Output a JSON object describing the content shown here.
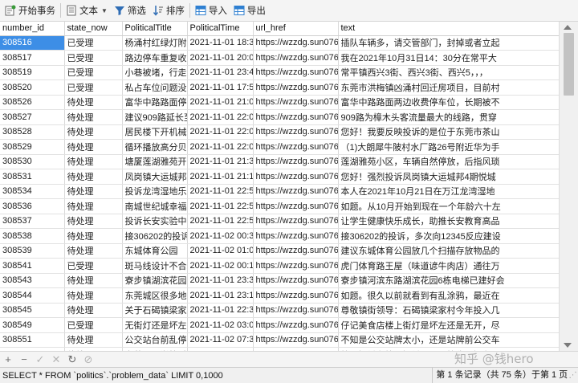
{
  "toolbar": {
    "begin_transaction": "开始事务",
    "text": "文本",
    "filter": "筛选",
    "sort": "排序",
    "import": "导入",
    "export": "导出"
  },
  "columns": [
    "number_id",
    "state_now",
    "PoliticalTitle",
    "PoliticalTime",
    "url_href",
    "text"
  ],
  "rows": [
    [
      "308516",
      "已受理",
      "杨涌村红绿灯附近",
      "2021-11-01 18:38",
      "https://wzzdg.sun0769",
      "插队车辆多，请交管部门，封掉或者立起"
    ],
    [
      "308517",
      "已受理",
      "路边停车重复收费",
      "2021-11-01 20:09",
      "https://wzzdg.sun0769",
      "我在2021年10月31日14：30分在常平大"
    ],
    [
      "308519",
      "已受理",
      "小巷被堵，行走不",
      "2021-11-01 23:41",
      "https://wzzdg.sun0769",
      "常平镇西兴3街、西兴3街、西兴5，，，"
    ],
    [
      "308520",
      "已受理",
      "私占车位问题没有",
      "2021-11-01 17:55",
      "https://wzzdg.sun0769",
      "东莞市洪梅镇凶涌村回迁房项目，目前村"
    ],
    [
      "308526",
      "待处理",
      "富华中路路面停车",
      "2021-11-01 21:09",
      "https://wzzdg.sun0769",
      "富华中路路面两边收费停车位，长期被不"
    ],
    [
      "308527",
      "待处理",
      "建议909路延长至",
      "2021-11-01 22:03",
      "https://wzzdg.sun0769",
      "909路为樟木头客流量最大的线路，贯穿"
    ],
    [
      "308528",
      "待处理",
      "居民楼下开机械厂",
      "2021-11-01 22:05",
      "https://wzzdg.sun0769",
      "您好！我要反映投诉的是位于东莞市茶山"
    ],
    [
      "308529",
      "待处理",
      "循环播放高分贝噪",
      "2021-11-01 22:00",
      "https://wzzdg.sun0769",
      "（1)大朗犀牛陂村水厂路26号附近华为手"
    ],
    [
      "308530",
      "待处理",
      "塘厦莲湖雅苑开发",
      "2021-11-01 21:39",
      "https://wzzdg.sun0769",
      "莲湖雅苑小区，车辆自然停放，后指风琐"
    ],
    [
      "308531",
      "待处理",
      "凤岗镇大运城邦四",
      "2021-11-01 21:18",
      "https://wzzdg.sun0769",
      "您好！强烈投诉凤岗镇大运城邦4期悦城"
    ],
    [
      "308534",
      "待处理",
      "投诉龙湾湿地乐园",
      "2021-11-01 22:58",
      "https://wzzdg.sun0769",
      "本人在2021年10月21日在万江龙湾湿地"
    ],
    [
      "308536",
      "待处理",
      "南城世纪城幸福公",
      "2021-11-01 22:57",
      "https://wzzdg.sun0769",
      "如题。从10月开始到现在一个年龄六十左"
    ],
    [
      "308537",
      "待处理",
      "投诉长安实验中学",
      "2021-11-01 22:53",
      "https://wzzdg.sun0769",
      "让学生健康快乐成长，助推长安教育高品"
    ],
    [
      "308538",
      "待处理",
      "接306202的投诉，",
      "2021-11-02 00:37",
      "https://wzzdg.sun0769",
      "接306202的投诉，多次向12345反应建设"
    ],
    [
      "308539",
      "待处理",
      "东城体育公园",
      "2021-11-02 01:07",
      "https://wzzdg.sun0769",
      "建议东城体育公园放几个扫描存放物品的"
    ],
    [
      "308541",
      "已受理",
      "斑马线设计不合理",
      "2021-11-02 00:11",
      "https://wzzdg.sun0769",
      "虎门体育路王屋（味道谚牛肉店）通往万"
    ],
    [
      "308543",
      "待处理",
      "寮步镇湖滨花园建",
      "2021-11-01 23:39",
      "https://wzzdg.sun0769",
      "寮步镇河滨东路湖滨花园6栋电梯已建好会"
    ],
    [
      "308544",
      "待处理",
      "东莞城区很多地方",
      "2021-11-01 23:18",
      "https://wzzdg.sun0769",
      "如题。很久以前就看到有乱涂鸦，最近在"
    ],
    [
      "308545",
      "待处理",
      "关于石碣镇梁家村",
      "2021-11-01 22:35",
      "https://wzzdg.sun0769",
      "尊敬镇街领导：石碣镇梁家村今年投入几"
    ],
    [
      "308549",
      "已受理",
      "无街灯还是坏左",
      "2021-11-02 03:01",
      "https://wzzdg.sun0769",
      "仔记美食店楼上街灯是坏左还是无开，尽"
    ],
    [
      "308551",
      "待处理",
      "公交站台前乱停乱",
      "2021-11-02 07:34",
      "https://wzzdg.sun0769",
      "不知是公交站牌太小，还是站牌前公交车"
    ],
    [
      "308552",
      "待处理",
      "东莞理工学校  食堂",
      "2021-11-01 20:58",
      "https://wzzdg.sun0769",
      "第一饭堂和第二饭堂（以下简称一饭和二"
    ]
  ],
  "selected_row_index": 0,
  "status": {
    "sql": "SELECT * FROM `politics`.`problem_data` LIMIT 0,1000",
    "record": "第 1 条记录（共 75 条）于第 1 页"
  },
  "watermark": "知乎 @钱hero",
  "colors": {
    "selected": "#3d8ee6",
    "toolbar_bg": "#f4f4f4",
    "filter_icon": "#2f6db5",
    "grid_icon": "#2e7fd1"
  },
  "icons": {
    "begin_transaction": "transaction-icon",
    "text": "text-doc-icon",
    "filter": "funnel-icon",
    "sort": "sort-icon",
    "import": "import-grid-icon",
    "export": "export-grid-icon"
  }
}
